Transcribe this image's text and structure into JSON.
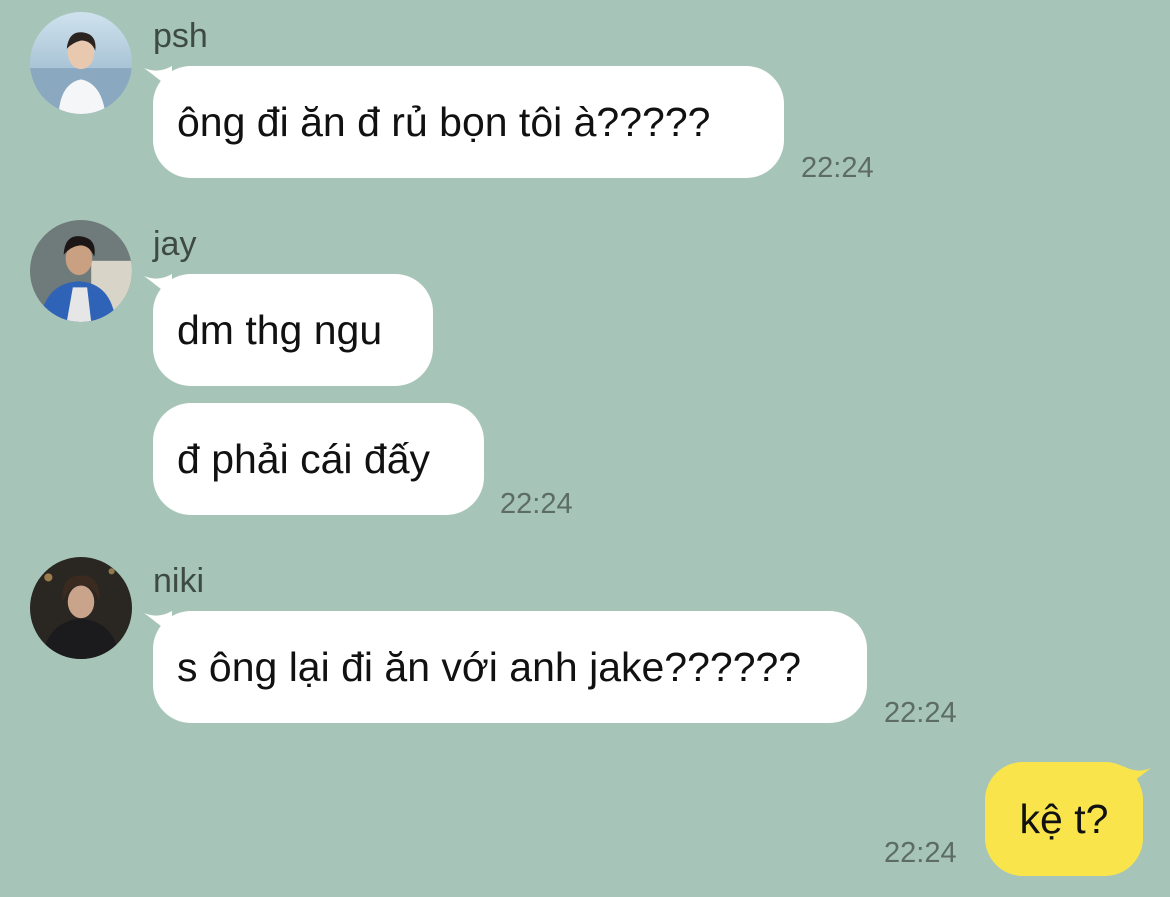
{
  "colors": {
    "background": "#a6c5b8",
    "incoming_bubble": "#ffffff",
    "outgoing_bubble": "#f9e54b",
    "timestamp": "#5d6c66",
    "sender_name": "#3d4a45"
  },
  "messages": {
    "psh": {
      "sender": "psh",
      "avatar_icon": "profile-photo-psh",
      "text": "ông đi ăn đ rủ bọn tôi à?????",
      "time": "22:24"
    },
    "jay": {
      "sender": "jay",
      "avatar_icon": "profile-photo-jay",
      "text_1": "dm thg ngu",
      "text_2": "đ phải cái đấy",
      "time": "22:24"
    },
    "niki": {
      "sender": "niki",
      "avatar_icon": "profile-photo-niki",
      "text": "s ông lại đi ăn với anh jake??????",
      "time": "22:24"
    },
    "me": {
      "text": "kệ t?",
      "time": "22:24"
    }
  }
}
